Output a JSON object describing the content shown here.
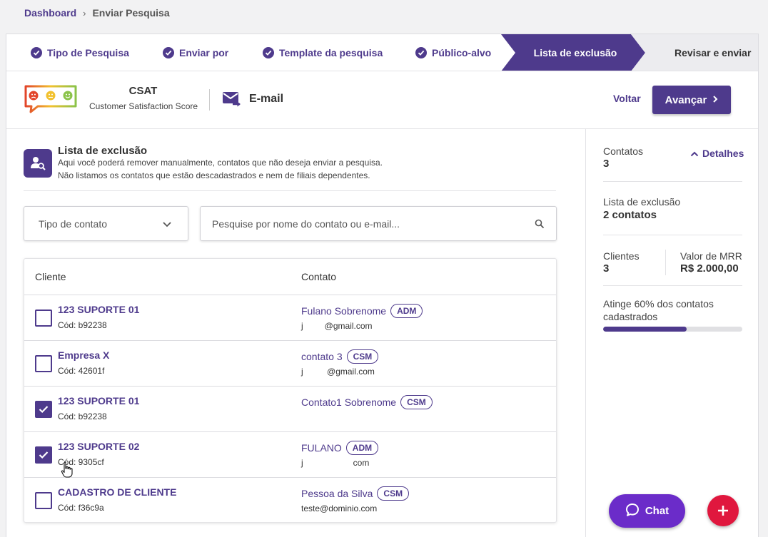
{
  "breadcrumb": {
    "home": "Dashboard",
    "separator": "›",
    "current": "Enviar Pesquisa"
  },
  "steps": [
    {
      "label": "Tipo de Pesquisa",
      "state": "done"
    },
    {
      "label": "Enviar por",
      "state": "done"
    },
    {
      "label": "Template da pesquisa",
      "state": "done"
    },
    {
      "label": "Público-alvo",
      "state": "done"
    },
    {
      "label": "Lista de exclusão",
      "state": "active"
    },
    {
      "label": "Revisar e enviar",
      "state": "pending"
    }
  ],
  "survey": {
    "type": "CSAT",
    "type_full": "Customer Satisfaction Score",
    "channel": "E-mail",
    "channel_icon": "email-send-icon"
  },
  "actions": {
    "back": "Voltar",
    "next": "Avançar"
  },
  "exclusion": {
    "title": "Lista de exclusão",
    "desc1": "Aqui você poderá remover manualmente, contatos que não deseja enviar a pesquisa.",
    "desc2": "Não listamos os contatos que estão descadastrados e nem de filiais dependentes.",
    "contact_type_placeholder": "Tipo de contato",
    "search_placeholder": "Pesquise por nome do contato ou e-mail..."
  },
  "table": {
    "headers": {
      "client": "Cliente",
      "contact": "Contato"
    },
    "rows": [
      {
        "client": "123 SUPORTE 01",
        "code": "Cód: b92238",
        "contact": "Fulano Sobrenome",
        "badge": "ADM",
        "email": "j         @gmail.com",
        "checked": false
      },
      {
        "client": "Empresa X",
        "code": "Cód: 42601f",
        "contact": "contato 3",
        "badge": "CSM",
        "email": "j          @gmail.com",
        "checked": false
      },
      {
        "client": "123 SUPORTE 01",
        "code": "Cód: b92238",
        "contact": "Contato1 Sobrenome",
        "badge": "CSM",
        "email": "",
        "checked": true
      },
      {
        "client": "123 SUPORTE 02",
        "code": "Cód: 9305cf",
        "contact": "FULANO",
        "badge": "ADM",
        "email": "j                     com",
        "checked": true
      },
      {
        "client": "CADASTRO DE CLIENTE",
        "code": "Cód: f36c9a",
        "contact": "Pessoa da Silva",
        "badge": "CSM",
        "email": "teste@dominio.com",
        "checked": false
      }
    ]
  },
  "summary": {
    "contacts_label": "Contatos",
    "contacts_value": "3",
    "details": "Detalhes",
    "exclusion_label": "Lista de exclusão",
    "exclusion_value": "2 contatos",
    "clients_label": "Clientes",
    "clients_value": "3",
    "mrr_label": "Valor de MRR",
    "mrr_value": "R$ 2.000,00",
    "reach_line1": "Atinge 60% dos contatos",
    "reach_line2": "cadastrados",
    "reach_fraction": 0.6
  },
  "chat": "Chat",
  "colors": {
    "primary": "#4e3a8c",
    "chat": "#6b2cc9",
    "fab": "#e0173e"
  }
}
